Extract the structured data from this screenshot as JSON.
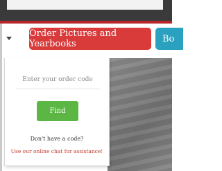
{
  "nav": {
    "order_button_label": "Order Pictures and Yearbooks",
    "second_button_label": "Bo",
    "dropdown_icon": "caret-down-icon"
  },
  "order_panel": {
    "code_placeholder": "Enter your order code",
    "code_value": "",
    "find_label": "Find",
    "no_code_text": "Don't have a code?",
    "chat_text": "Use our online chat for assistance!"
  },
  "colors": {
    "order_button": "#d93a3a",
    "second_button": "#2aa1bf",
    "find_button": "#5cb644",
    "divider": "#b8252b",
    "chat_link": "#c0392b"
  }
}
